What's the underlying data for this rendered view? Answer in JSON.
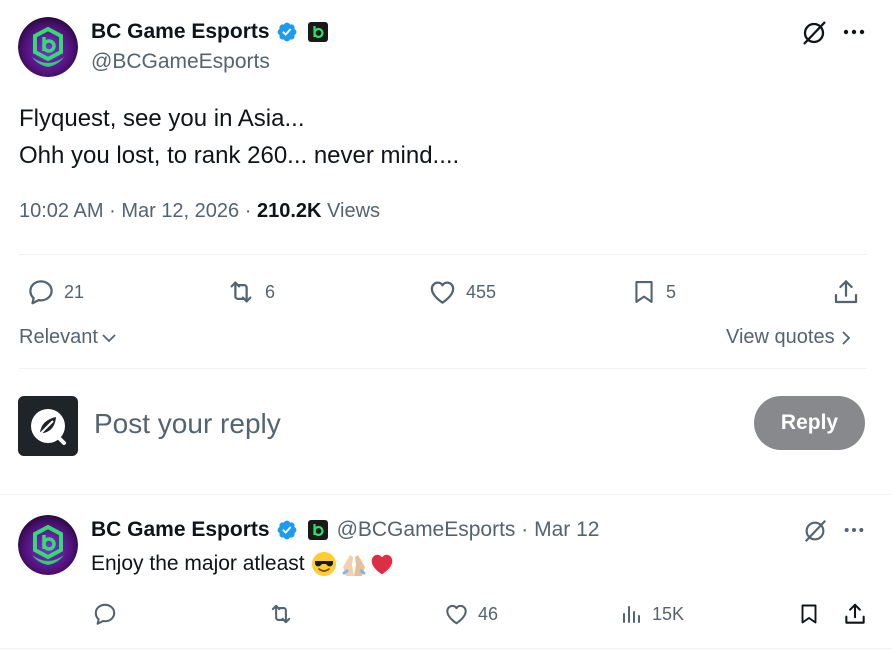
{
  "author": {
    "display_name": "BC Game Esports",
    "handle": "@BCGameEsports"
  },
  "tweet": {
    "lines": [
      "Flyquest, see you in Asia...",
      "Ohh you lost, to rank 260... never mind...."
    ],
    "time": "10:02 AM",
    "date": "Mar 12, 2026",
    "views_count": "210.2K",
    "views_label": "Views",
    "separator": "·"
  },
  "actions": {
    "replies": "21",
    "reposts": "6",
    "likes": "455",
    "bookmarks": "5"
  },
  "sort": {
    "label": "Relevant",
    "view_quotes": "View quotes"
  },
  "composer": {
    "placeholder": "Post your reply",
    "button": "Reply"
  },
  "reply": {
    "display_name": "BC Game Esports",
    "handle_date": "@BCGameEsports · Mar 12",
    "text": "Enjoy the major atleast",
    "emojis": [
      "sunglasses-emoji",
      "folded-hands-emoji",
      "red-heart-emoji"
    ],
    "actions": {
      "replies": "",
      "reposts": "",
      "likes": "46",
      "views": "15K"
    }
  },
  "colors": {
    "brand_green": "#2ee06b",
    "avatar_purple": "#5a1e8c",
    "verified_blue": "#1d9bf0",
    "secondary_text": "#536471",
    "reply_button_disabled": "#87898c"
  }
}
